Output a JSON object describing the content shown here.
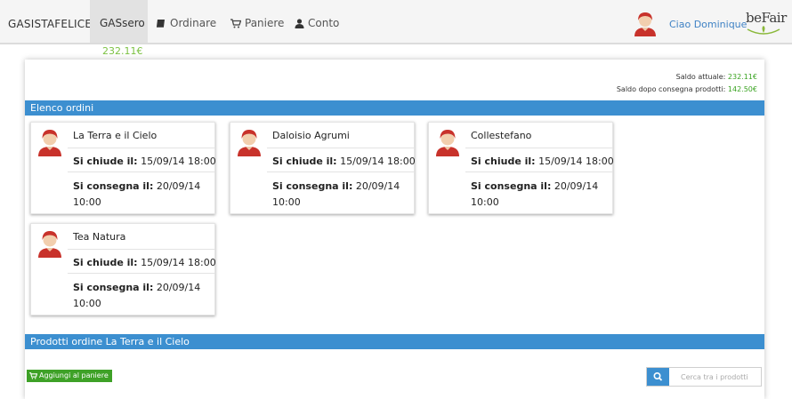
{
  "navbar": {
    "brand": "GASISTAFELICE",
    "active_item": "GASsero",
    "items": [
      {
        "label": "Ordinare",
        "icon": "book-icon"
      },
      {
        "label": "Paniere",
        "icon": "cart-icon"
      },
      {
        "label": "Conto",
        "icon": "user-icon"
      }
    ],
    "balance": "232.11€",
    "greeting": "Ciao Dominique",
    "logo_text": "beFair"
  },
  "saldo": {
    "current_label": "Saldo attuale:",
    "current_value": "232.11€",
    "after_label": "Saldo dopo consegna prodotti:",
    "after_value": "142.50€"
  },
  "orders": {
    "title": "Elenco ordini",
    "closes_label": "Si chiude il:",
    "delivers_label": "Si consegna il:",
    "items": [
      {
        "name": "La Terra e il Cielo",
        "closes": "15/09/14 18:00",
        "delivers": "20/09/14 10:00"
      },
      {
        "name": "Daloisio Agrumi",
        "closes": "15/09/14 18:00",
        "delivers": "20/09/14 10:00"
      },
      {
        "name": "Collestefano",
        "closes": "15/09/14 18:00",
        "delivers": "20/09/14 10:00"
      },
      {
        "name": "Tea Natura",
        "closes": "15/09/14 18:00",
        "delivers": "20/09/14 10:00"
      }
    ]
  },
  "products": {
    "title": "Prodotti ordine La Terra e il Cielo",
    "add_button": "Aggiungi al paniere",
    "search_placeholder": "Cerca tra i prodotti"
  },
  "colors": {
    "accent_blue": "#3c8fd0",
    "balance_green": "#3aa321",
    "button_green": "#3ea127"
  }
}
